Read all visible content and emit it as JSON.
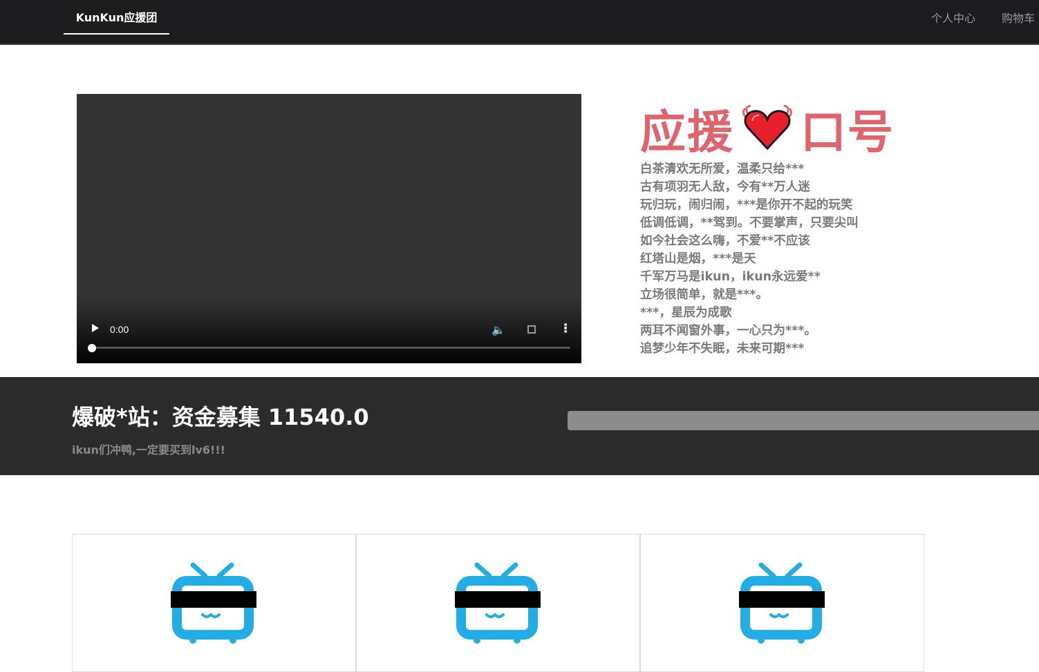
{
  "navbar": {
    "brand": "KunKun应援团",
    "links": [
      "个人中心",
      "购物车"
    ]
  },
  "video": {
    "time": "0:00",
    "progress": 0
  },
  "slogan": {
    "title_left": "应援",
    "title_right": "口号",
    "heart_icon": "heart-icon",
    "lines": [
      "白茶清欢无所爱，温柔只给***",
      "古有项羽无人敌，今有**万人迷",
      "玩归玩，闹归闹，***是你开不起的玩笑",
      "低调低调，**驾到。不要掌声，只要尖叫",
      "如今社会这么嗨，不爱**不应该",
      "红塔山是烟，***是天",
      "千军万马是ikun，ikun永远爱**",
      "立场很简单，就是***。",
      "***，星辰为成歌",
      "两耳不闻窗外事，一心只为***。",
      "追梦少年不失眠，未来可期***"
    ],
    "colors": {
      "title": "#e0646b",
      "text": "#7a7a7a"
    }
  },
  "funding": {
    "title": "爆破*站：资金募集 11540.0",
    "subtitle": "ikun们冲鸭,一定要买到lv6!!!",
    "progress": 1.0
  },
  "cards": [
    {
      "icon": "bilibili-tv-icon"
    },
    {
      "icon": "bilibili-tv-icon"
    },
    {
      "icon": "bilibili-tv-icon"
    }
  ],
  "colors": {
    "navbar": "#1c1c1e",
    "band": "#2b2b2b",
    "tv_blue": "#23ade5"
  }
}
